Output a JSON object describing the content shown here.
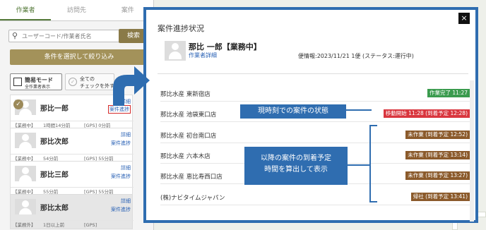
{
  "sidebar": {
    "tabs": [
      {
        "label": "作業者"
      },
      {
        "label": "訪問先"
      },
      {
        "label": "案件"
      }
    ],
    "search": {
      "placeholder": "ユーザーコード/作業者氏名",
      "button": "検索"
    },
    "filter_button": "条件を選択して絞り込み",
    "mode": {
      "title": "簡易モード",
      "subtitle": "全作業者表示"
    },
    "check_all": {
      "line1": "全ての",
      "line2": "チェックを外す"
    },
    "workers": [
      {
        "name": "那比一郎",
        "link1": "詳細",
        "link2": "案件進捗",
        "status": "【業務中】",
        "time": "1時間14分前",
        "gps": "[GPS] 0分前"
      },
      {
        "name": "那比次郎",
        "link1": "詳細",
        "link2": "案件進捗",
        "status": "【業務中】",
        "time": "54分前",
        "gps": "[GPS] 55分前"
      },
      {
        "name": "那比三郎",
        "link1": "詳細",
        "link2": "案件進捗",
        "status": "【業務中】",
        "time": "55分前",
        "gps": "[GPS] 55分前"
      },
      {
        "name": "那比太郎",
        "link1": "詳細",
        "link2": "案件進捗",
        "status": "【業務外】",
        "time": "1日以上前",
        "gps": "[GPS]"
      }
    ]
  },
  "modal": {
    "title": "案件進捗状況",
    "close_icon": "×",
    "worker_name": "那比 一郎【業務中】",
    "detail_link": "作業者詳細",
    "flight_info": "便情報:2023/11/21 1便 (ステータス:運行中)",
    "rows": [
      {
        "name": "那比水産 東新宿店",
        "status": "作業完了 11:27",
        "color": "#3a9b4e"
      },
      {
        "name": "那比水産 池袋東口店",
        "status": "移動開始 11:28 (到着予定 12:28)",
        "color": "#d9363e"
      },
      {
        "name": "那比水産 初台南口店",
        "status": "未作業 (到着予定 12:52)",
        "color": "#8b5a2b"
      },
      {
        "name": "那比水産 六本木店",
        "status": "未作業 (到着予定 13:14)",
        "color": "#8b5a2b"
      },
      {
        "name": "那比水産 恵比寿西口店",
        "status": "未作業 (到着予定 13:27)",
        "color": "#8b5a2b"
      },
      {
        "name": "(株)ナビタイムジャパン",
        "status": "帰社 (到着予定 13:41)",
        "color": "#8b5a2b"
      }
    ]
  },
  "callouts": {
    "current": "現時刻での案件の状態",
    "future_line1": "以降の案件の到着予定",
    "future_line2": "時間を算出して表示"
  },
  "colors": {
    "accent": "#2f6db0",
    "brand": "#8a7a48"
  }
}
